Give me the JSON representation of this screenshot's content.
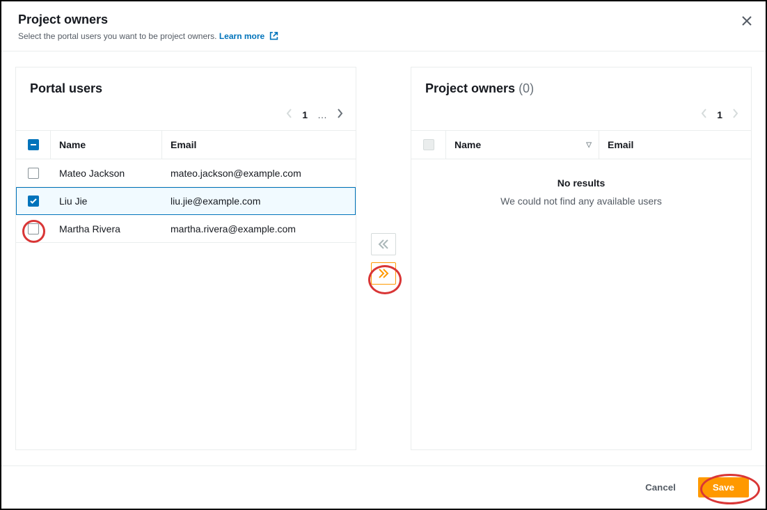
{
  "header": {
    "title": "Project owners",
    "description": "Select the portal users you want to be project owners.",
    "learn_more": "Learn more"
  },
  "left_panel": {
    "title": "Portal users",
    "pagination": {
      "page": "1",
      "ellipsis": "…"
    },
    "columns": {
      "name": "Name",
      "email": "Email"
    },
    "rows": [
      {
        "name": "Mateo Jackson",
        "email": "mateo.jackson@example.com",
        "checked": false
      },
      {
        "name": "Liu Jie",
        "email": "liu.jie@example.com",
        "checked": true
      },
      {
        "name": "Martha Rivera",
        "email": "martha.rivera@example.com",
        "checked": false
      }
    ]
  },
  "right_panel": {
    "title": "Project owners",
    "count": "(0)",
    "pagination": {
      "page": "1"
    },
    "columns": {
      "name": "Name",
      "email": "Email"
    },
    "empty_title": "No results",
    "empty_text": "We could not find any available users"
  },
  "footer": {
    "cancel": "Cancel",
    "save": "Save"
  }
}
